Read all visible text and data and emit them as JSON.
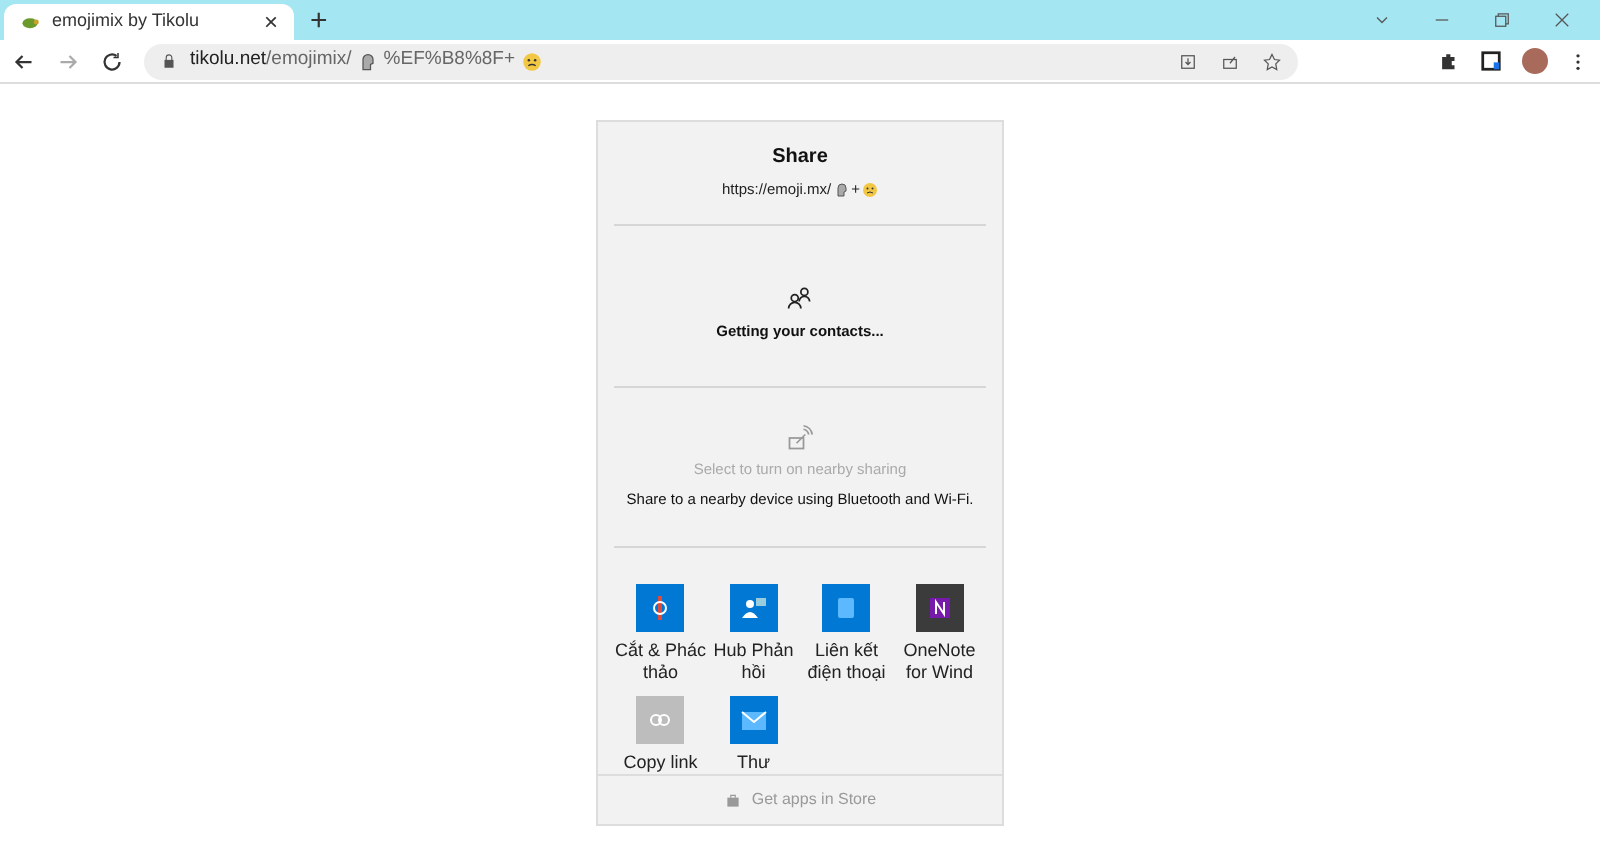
{
  "tab": {
    "title": "emojimix by Tikolu",
    "close": "×",
    "new_tab": "+"
  },
  "address": {
    "host": "tikolu.net",
    "path": "/emojimix/",
    "encoded": "%EF%B8%8F+"
  },
  "share": {
    "title": "Share",
    "url_prefix": "https://emoji.mx/",
    "url_plus": "+",
    "contacts_status": "Getting your contacts...",
    "nearby_title": "Select to turn on nearby sharing",
    "nearby_desc": "Share to a nearby device using Bluetooth and Wi-Fi.",
    "apps": [
      {
        "label": "Cắt & Phác thảo",
        "kind": "snip"
      },
      {
        "label": "Hub Phản hồi",
        "kind": "feedback"
      },
      {
        "label": "Liên kết điện thoại",
        "kind": "phone"
      },
      {
        "label": "OneNote for Wind",
        "kind": "onenote"
      },
      {
        "label": "Copy link",
        "kind": "link"
      },
      {
        "label": "Thư",
        "kind": "mail"
      }
    ],
    "store": "Get apps in Store"
  }
}
